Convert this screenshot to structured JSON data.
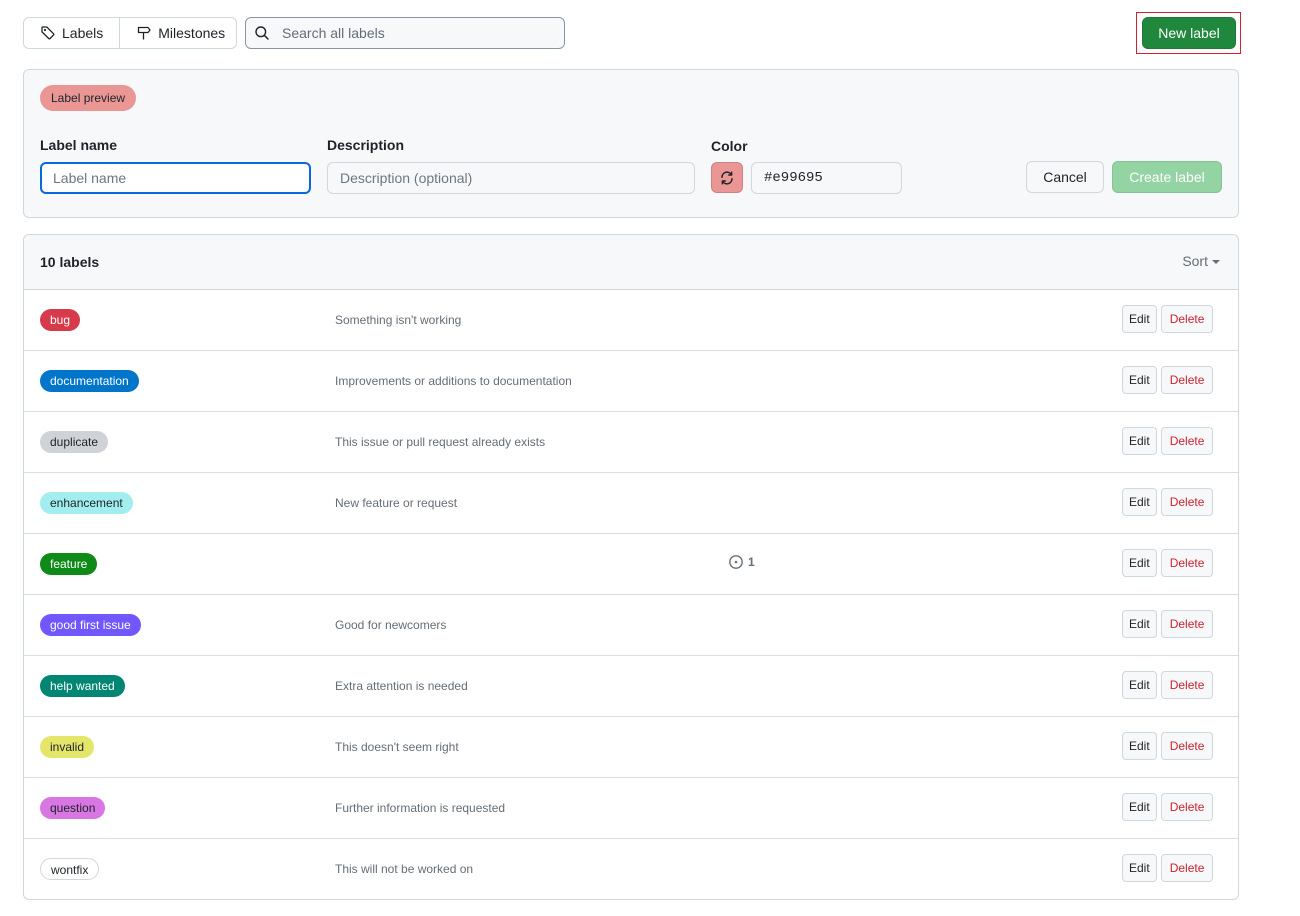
{
  "nav": {
    "labels": "Labels",
    "milestones": "Milestones",
    "search_placeholder": "Search all labels",
    "new_label": "New label"
  },
  "form": {
    "preview_label": "Label preview",
    "preview_color": "#e99695",
    "name_label": "Label name",
    "name_placeholder": "Label name",
    "description_label": "Description",
    "description_placeholder": "Description (optional)",
    "color_label": "Color",
    "color_value": "#e99695",
    "refresh_icon": "sync-icon",
    "cancel": "Cancel",
    "create": "Create label"
  },
  "list": {
    "count": "10 labels",
    "sort": "Sort",
    "edit": "Edit",
    "delete": "Delete",
    "labels": [
      {
        "name": "bug",
        "color": "#d73a4a",
        "text_color": "#ffffff",
        "description": "Something isn't working"
      },
      {
        "name": "documentation",
        "color": "#0075ca",
        "text_color": "#ffffff",
        "description": "Improvements or additions to documentation"
      },
      {
        "name": "duplicate",
        "color": "#cfd3d7",
        "text_color": "#1f2328",
        "description": "This issue or pull request already exists"
      },
      {
        "name": "enhancement",
        "color": "#a2eeef",
        "text_color": "#1f2328",
        "description": "New feature or request"
      },
      {
        "name": "feature",
        "color": "#0e8a16",
        "text_color": "#ffffff",
        "description": "",
        "open_issues": "1"
      },
      {
        "name": "good first issue",
        "color": "#7057ff",
        "text_color": "#ffffff",
        "description": "Good for newcomers"
      },
      {
        "name": "help wanted",
        "color": "#008672",
        "text_color": "#ffffff",
        "description": "Extra attention is needed"
      },
      {
        "name": "invalid",
        "color": "#e4e669",
        "text_color": "#1f2328",
        "description": "This doesn't seem right"
      },
      {
        "name": "question",
        "color": "#d876e3",
        "text_color": "#1f2328",
        "description": "Further information is requested"
      },
      {
        "name": "wontfix",
        "color": "#ffffff",
        "text_color": "#1f2328",
        "description": "This will not be worked on"
      }
    ]
  }
}
